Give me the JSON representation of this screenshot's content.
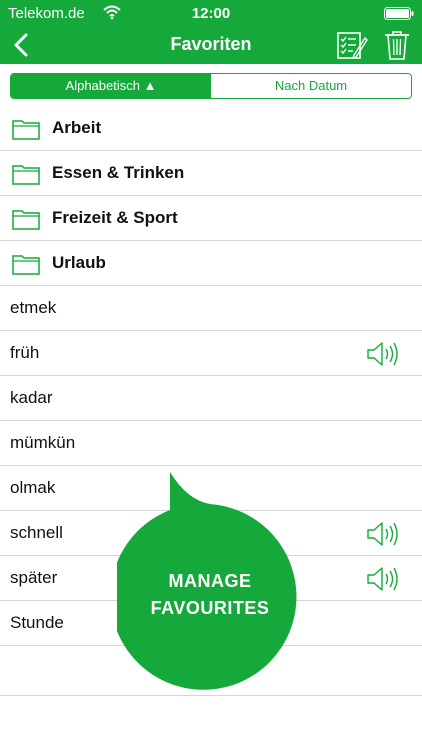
{
  "status_bar": {
    "carrier": "Telekom.de",
    "time": "12:00"
  },
  "nav": {
    "title": "Favoriten",
    "icons": [
      "back-chevron-icon",
      "edit-list-icon",
      "trash-icon"
    ]
  },
  "segments": {
    "alphabetical": "Alphabetisch ▲",
    "by_date": "Nach Datum",
    "selected": "alphabetical"
  },
  "folders": [
    {
      "label": "Arbeit"
    },
    {
      "label": "Essen & Trinken"
    },
    {
      "label": "Freizeit & Sport"
    },
    {
      "label": "Urlaub"
    }
  ],
  "words": [
    {
      "label": "etmek",
      "audio": false
    },
    {
      "label": "früh",
      "audio": true
    },
    {
      "label": "kadar",
      "audio": false
    },
    {
      "label": "mümkün",
      "audio": false
    },
    {
      "label": "olmak",
      "audio": false
    },
    {
      "label": "schnell",
      "audio": true
    },
    {
      "label": "später",
      "audio": true
    },
    {
      "label": "Stunde",
      "audio": false
    }
  ],
  "manage_bubble": {
    "line1": "MANAGE",
    "line2": "FAVOURITES"
  },
  "colors": {
    "accent": "#14a93a",
    "separator": "#d6d6d6",
    "text": "#111111"
  }
}
